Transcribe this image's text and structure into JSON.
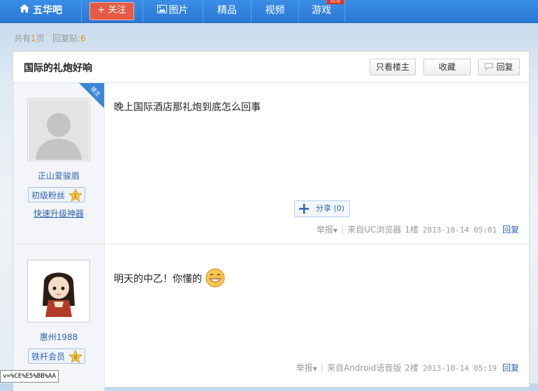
{
  "nav": {
    "brand": "五华吧",
    "follow": "关注",
    "items": [
      "图片",
      "精品",
      "视频",
      "游戏"
    ],
    "new_badge": "NEW"
  },
  "summary": {
    "pages_prefix": "共有",
    "pages_num": "1",
    "pages_suffix": "页",
    "replies_label": "回复贴:",
    "replies_num": "6"
  },
  "thread": {
    "title": "国际的礼炮好响",
    "btn_owner_only": "只看楼主",
    "btn_favorite": "收藏",
    "btn_reply": "回复"
  },
  "posts": [
    {
      "owner_badge": "楼主",
      "username": "正山爱骏眉",
      "level_name": "初级粉丝",
      "level_num": "1",
      "upgrade_link": "快速升级神器",
      "content": "晚上国际酒店那礼炮到底怎么回事",
      "share_label": "分享 (0)",
      "report": "举报",
      "source": "来自UC浏览器",
      "floor": "1楼",
      "time": "2013-10-14 05:01",
      "reply": "回复"
    },
    {
      "username": "惠州1988",
      "level_name": "铁杆会员",
      "level_num": "8",
      "content": "明天的中乙！你懂的",
      "report": "举报",
      "source": "来自Android语音版",
      "floor": "2楼",
      "time": "2013-10-14 05:19",
      "reply": "回复"
    }
  ],
  "status_bar": "v=%CE%E5%BB%AA",
  "colors": {
    "nav_blue": "#2a78d6",
    "follow_red": "#e55a45",
    "link_blue": "#2d64b3",
    "count_orange": "#f0900a",
    "badge_blue": "#3a86d8"
  },
  "icons": [
    "home-icon",
    "plus-icon",
    "image-icon",
    "owner-corner-badge",
    "star-level-icon",
    "share-plus-icon",
    "speech-bubble-icon",
    "caret-down-icon",
    "grin-emoji-icon"
  ]
}
